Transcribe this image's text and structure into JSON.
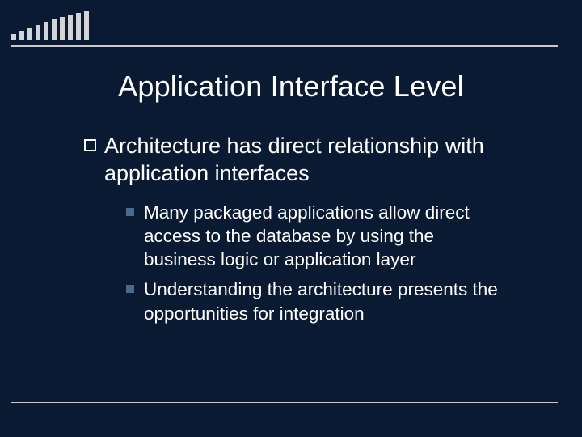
{
  "slide": {
    "title": "Application Interface Level",
    "level1": [
      {
        "text": "Architecture has direct relationship with application interfaces"
      }
    ],
    "level2": [
      {
        "text": "Many packaged applications allow direct access to the database by using the business logic or application layer"
      },
      {
        "text": "Understanding the architecture presents the opportunities for integration"
      }
    ]
  }
}
